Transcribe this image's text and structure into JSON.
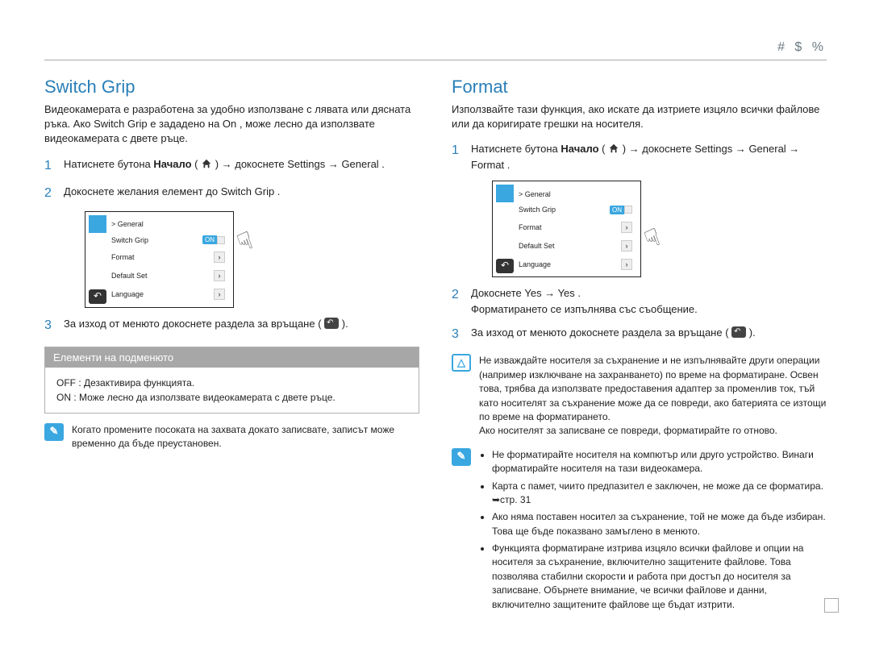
{
  "top_bar": "# $    %",
  "left": {
    "title": "Switch Grip",
    "intro": "Видеокамерата е разработена за удобно използване с лявата или дясната ръка. Ако Switch Grip е зададено на On , може лесно да използвате видеокамерата с двете ръце.",
    "steps": {
      "s1_a": "Натиснете бутона ",
      "s1_home": "Начало",
      "s1_b": " ( ",
      "s1_c": " ) → докоснете Settings → General .",
      "s2": "Докоснете желания елемент до Switch Grip .",
      "s3": "За изход от менюто докоснете раздела за връщане ( ",
      "s3_b": " )."
    },
    "submenu": {
      "head": "Елементи на подменюто",
      "off": "OFF : Дезактивира функцията.",
      "on": "ON : Може лесно да използвате видеокамерата с двете ръце."
    },
    "note": "Когато промените посоката на захвата докато записвате, записът може временно да бъде преустановен."
  },
  "right": {
    "title": "Format",
    "intro": "Използвайте тази функция, ако искате да изтриете изцяло всички файлове или да коригирате грешки на носителя.",
    "steps": {
      "s1_a": "Натиснете бутона ",
      "s1_home": "Начало",
      "s1_b": " ( ",
      "s1_c": " ) → докоснете Settings → General → Format .",
      "s2_a": "Докоснете Yes → Yes .",
      "s2_b": "Форматирането се изпълнява със съобщение.",
      "s3": "За изход от менюто докоснете раздела за връщане ( ",
      "s3_b": " )."
    },
    "warn": "Не изваждайте носителя за съхранение и не изпълнявайте други операции (например изключване на захранването) по време на форматиране. Освен това, трябва да използвате предоставения адаптер за променлив ток, тъй като носителят за съхранение може да се повреди, ако батерията се изтощи по време на форматирането.\nАко носителят за записване се повреди, форматирайте го отново.",
    "info_items": [
      "Не форматирайте носителя на компютър или друго устройство. Винаги форматирайте носителя на тази видеокамера.",
      "Карта с памет, чиито предпазител е заключен, не може да се форматира. ➥стр. 31",
      "Ако няма поставен носител за съхранение, той не може да бъде избиран. Това ще бъде показвано замъглено в менюто.",
      "Функцията форматиране изтрива изцяло всички файлове и опции на носителя за съхранение, включително защитените файлове. Това позволява стабилни скорости и работа при достъп до носителя за записване. Обърнете внимание, че всички файлове и данни, включително защитените файлове ще бъдат изтрити."
    ]
  },
  "menu": {
    "breadcrumb": "> General",
    "items": [
      "Switch Grip",
      "Format",
      "Default Set",
      "Language"
    ],
    "on_label": "ON"
  },
  "page_num": ""
}
